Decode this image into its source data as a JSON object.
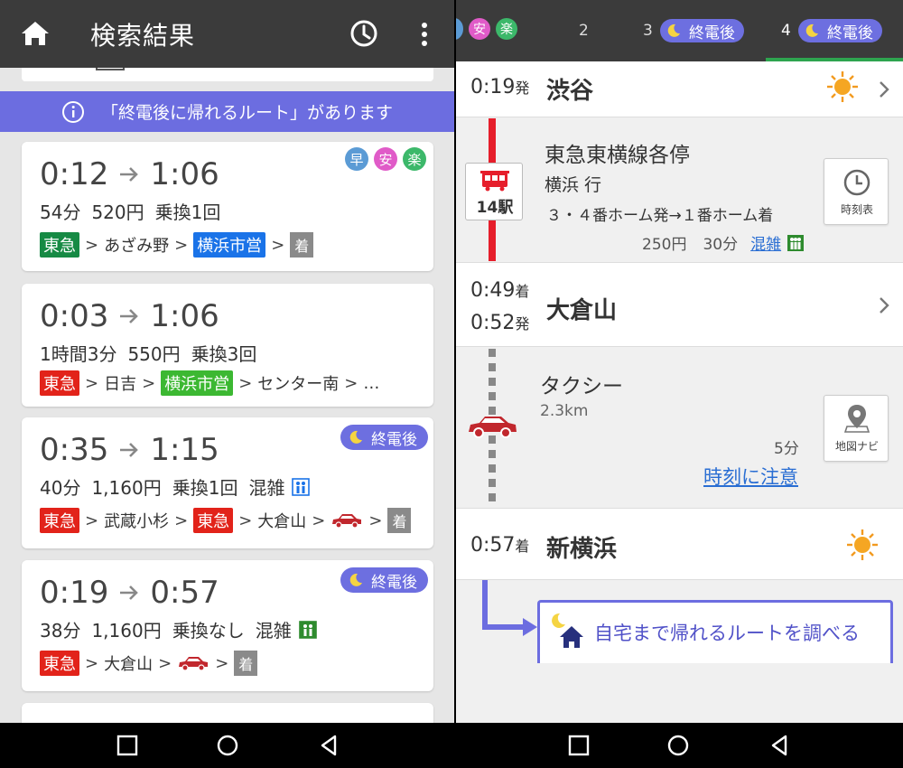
{
  "left": {
    "title": "検索結果",
    "peek_text": "……",
    "notice": "「終電後に帰れるルート」があります",
    "routes": [
      {
        "dep": "0:12",
        "arr": "1:06",
        "duration": "54分",
        "fare": "520円",
        "transfers": "乗換1回",
        "crowd": "",
        "badges": [
          "早",
          "安",
          "楽"
        ],
        "pill": "",
        "segments": [
          {
            "type": "tag",
            "text": "東急",
            "color": "#168a44"
          },
          {
            "type": "sep",
            "text": ">"
          },
          {
            "type": "text",
            "text": "あざみ野"
          },
          {
            "type": "sep",
            "text": ">"
          },
          {
            "type": "tag",
            "text": "横浜市営",
            "color": "#1a73e8"
          },
          {
            "type": "sep",
            "text": ">"
          },
          {
            "type": "arrive",
            "text": "着"
          }
        ]
      },
      {
        "dep": "0:03",
        "arr": "1:06",
        "duration": "1時間3分",
        "fare": "550円",
        "transfers": "乗換3回",
        "crowd": "",
        "badges": [],
        "pill": "",
        "segments": [
          {
            "type": "tag",
            "text": "東急",
            "color": "#e2231a"
          },
          {
            "type": "sep",
            "text": ">"
          },
          {
            "type": "text",
            "text": "日吉"
          },
          {
            "type": "sep",
            "text": ">"
          },
          {
            "type": "tag",
            "text": "横浜市営",
            "color": "#3cb832"
          },
          {
            "type": "sep",
            "text": ">"
          },
          {
            "type": "text",
            "text": "センター南"
          },
          {
            "type": "sep",
            "text": ">"
          },
          {
            "type": "text",
            "text": "…"
          }
        ]
      },
      {
        "dep": "0:35",
        "arr": "1:15",
        "duration": "40分",
        "fare": "1,160円",
        "transfers": "乗換1回",
        "crowd": "混雑",
        "badges": [],
        "pill": "終電後",
        "segments": [
          {
            "type": "tag",
            "text": "東急",
            "color": "#e2231a"
          },
          {
            "type": "sep",
            "text": ">"
          },
          {
            "type": "text",
            "text": "武蔵小杉"
          },
          {
            "type": "sep",
            "text": ">"
          },
          {
            "type": "tag",
            "text": "東急",
            "color": "#e2231a"
          },
          {
            "type": "sep",
            "text": ">"
          },
          {
            "type": "text",
            "text": "大倉山"
          },
          {
            "type": "sep",
            "text": ">"
          },
          {
            "type": "car",
            "text": ""
          },
          {
            "type": "sep",
            "text": ">"
          },
          {
            "type": "arrive",
            "text": "着"
          }
        ]
      },
      {
        "dep": "0:19",
        "arr": "0:57",
        "duration": "38分",
        "fare": "1,160円",
        "transfers": "乗換なし",
        "crowd": "混雑",
        "badges": [],
        "pill": "終電後",
        "segments": [
          {
            "type": "tag",
            "text": "東急",
            "color": "#e2231a"
          },
          {
            "type": "sep",
            "text": ">"
          },
          {
            "type": "text",
            "text": "大倉山"
          },
          {
            "type": "sep",
            "text": ">"
          },
          {
            "type": "car",
            "text": ""
          },
          {
            "type": "sep",
            "text": ">"
          },
          {
            "type": "arrive",
            "text": "着"
          }
        ]
      }
    ]
  },
  "badge_colors": {
    "早": "#5b9bd5",
    "安": "#e05bc8",
    "楽": "#3cb86a"
  },
  "right": {
    "tabs": [
      {
        "num": "",
        "badges": [
          "安",
          "楽"
        ],
        "pill": ""
      },
      {
        "num": "2",
        "badges": [],
        "pill": ""
      },
      {
        "num": "3",
        "badges": [],
        "pill": "終電後"
      },
      {
        "num": "4",
        "badges": [],
        "pill": "終電後"
      }
    ],
    "dep1": {
      "time": "0:19",
      "suffix": "発",
      "station": "渋谷"
    },
    "train": {
      "line": "東急東横線各停",
      "dest": "横浜 行",
      "platform": "３・４番ホーム発→１番ホーム着",
      "fare": "250円",
      "duration": "30分",
      "crowd": "混雑",
      "stops": "14駅",
      "timetable_label": "時刻表"
    },
    "stop2": {
      "arr_time": "0:49",
      "arr_suffix": "着",
      "dep_time": "0:52",
      "dep_suffix": "発",
      "station": "大倉山"
    },
    "taxi": {
      "label": "タクシー",
      "distance": "2.3km",
      "duration": "5分",
      "warning": "時刻に注意",
      "map_label": "地図ナビ"
    },
    "arrival": {
      "time": "0:57",
      "suffix": "着",
      "station": "新横浜"
    },
    "home_link": "自宅まで帰れるルートを調べる"
  }
}
